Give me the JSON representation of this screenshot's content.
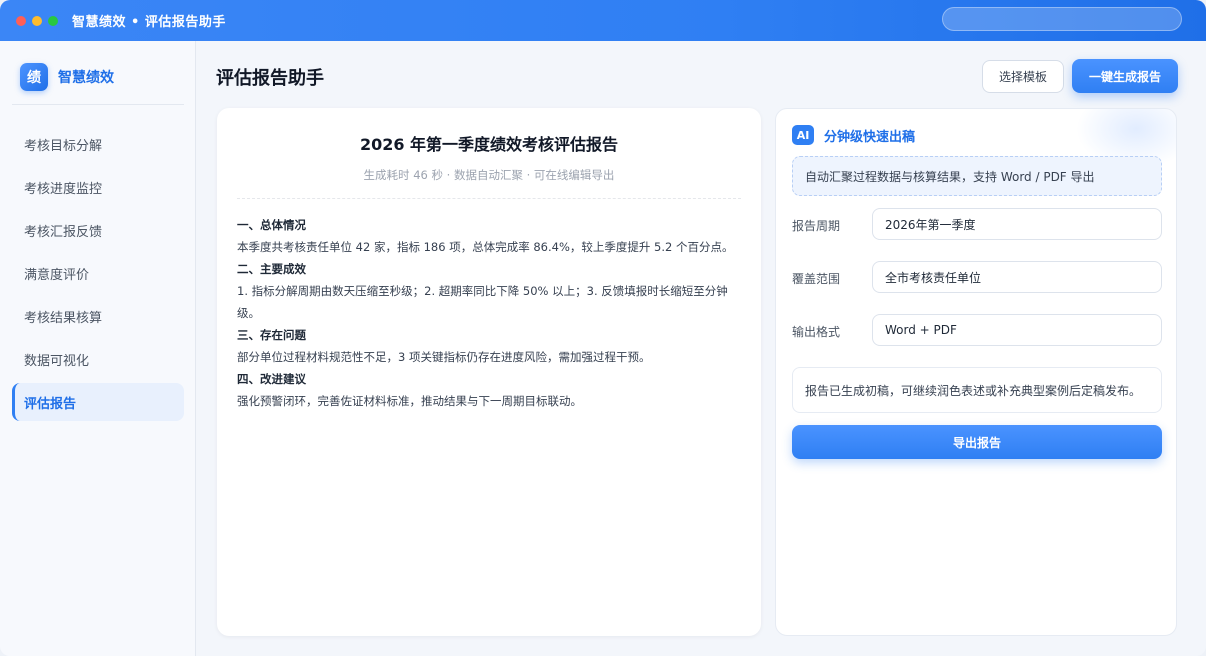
{
  "window": {
    "title": "智慧绩效 • 评估报告助手"
  },
  "sidebar": {
    "brand_logo": "绩",
    "brand_name": "智慧绩效",
    "items": [
      {
        "label": "考核目标分解"
      },
      {
        "label": "考核进度监控"
      },
      {
        "label": "考核汇报反馈"
      },
      {
        "label": "满意度评价"
      },
      {
        "label": "考核结果核算"
      },
      {
        "label": "数据可视化"
      },
      {
        "label": "评估报告",
        "active": true
      }
    ]
  },
  "header": {
    "title": "评估报告助手",
    "template_button": "选择模板",
    "generate_button": "一键生成报告"
  },
  "report": {
    "title": "2026 年第一季度绩效考核评估报告",
    "subtitle": "生成耗时 46 秒 · 数据自动汇聚 · 可在线编辑导出",
    "sections": [
      {
        "heading": "一、总体情况",
        "text": "本季度共考核责任单位 42 家，指标 186 项，总体完成率 86.4%，较上季度提升 5.2 个百分点。"
      },
      {
        "heading": "二、主要成效",
        "text": "1. 指标分解周期由数天压缩至秒级；2. 超期率同比下降 50% 以上；3. 反馈填报时长缩短至分钟级。"
      },
      {
        "heading": "三、存在问题",
        "text": "部分单位过程材料规范性不足，3 项关键指标仍存在进度风险，需加强过程干预。"
      },
      {
        "heading": "四、改进建议",
        "text": "强化预警闭环，完善佐证材料标准，推动结果与下一周期目标联动。"
      }
    ]
  },
  "panel": {
    "badge": "AI",
    "title": "分钟级快速出稿",
    "note": "自动汇聚过程数据与核算结果，支持 Word / PDF 导出",
    "fields": [
      {
        "label": "报告周期",
        "value": "2026年第一季度"
      },
      {
        "label": "覆盖范围",
        "value": "全市考核责任单位"
      },
      {
        "label": "输出格式",
        "value": "Word + PDF"
      }
    ],
    "status": "报告已生成初稿，可继续润色表述或补充典型案例后定稿发布。",
    "export_button": "导出报告"
  },
  "colors": {
    "accent": "#2f7ff3",
    "brand": "#1f6fe8"
  }
}
